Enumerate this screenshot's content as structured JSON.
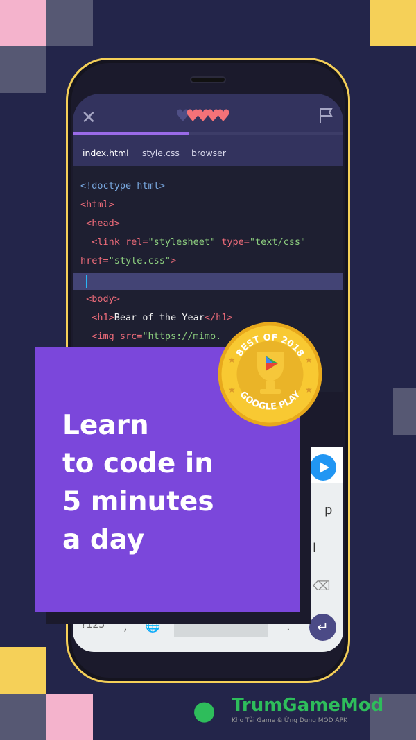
{
  "colors": {
    "background": "#23254a",
    "pink": "#f4b3cc",
    "yellow": "#f5d058",
    "grey": "#565873",
    "card": "#7b47db",
    "heart": "#f47278",
    "progress": "#9a6be8"
  },
  "header": {
    "close_icon": "close-icon",
    "flag_icon": "flag-icon",
    "hearts_total": 5,
    "hearts_filled": 4,
    "progress_percent": 43
  },
  "tabs": [
    {
      "label": "index.html",
      "active": true
    },
    {
      "label": "style.css"
    },
    {
      "label": "browser"
    }
  ],
  "code": {
    "l1": "<!doctype html>",
    "l2": "<html>",
    "l3": " <head>",
    "l4a": "  <link rel=",
    "l4b": "\"stylesheet\"",
    "l4c": " type=",
    "l4d": "\"text/css\"",
    "l5a": "href=",
    "l5b": "\"style.css\"",
    "l5c": ">",
    "l7": " <body>",
    "l8a": "  <h1>",
    "l8b": "Bear of the Year",
    "l8c": "</h1>",
    "l9a": "  <img src=",
    "l9b": "\"https://mimo."
  },
  "keyboard": {
    "k_p": "p",
    "k_l": "l",
    "k_123": "?123",
    "k_comma": ",",
    "k_period": ".",
    "enter": "↵",
    "backspace": "⌫"
  },
  "promo": {
    "line1": "Learn",
    "line2": "to code in",
    "line3": "5 minutes",
    "line4": "a day"
  },
  "badge": {
    "top": "BEST OF 2018",
    "bottom": "GOOGLE PLAY"
  },
  "watermark": {
    "brand": "TrumGameMod",
    "tagline": "Kho Tải Game & Ứng Dụng MOD APK"
  }
}
